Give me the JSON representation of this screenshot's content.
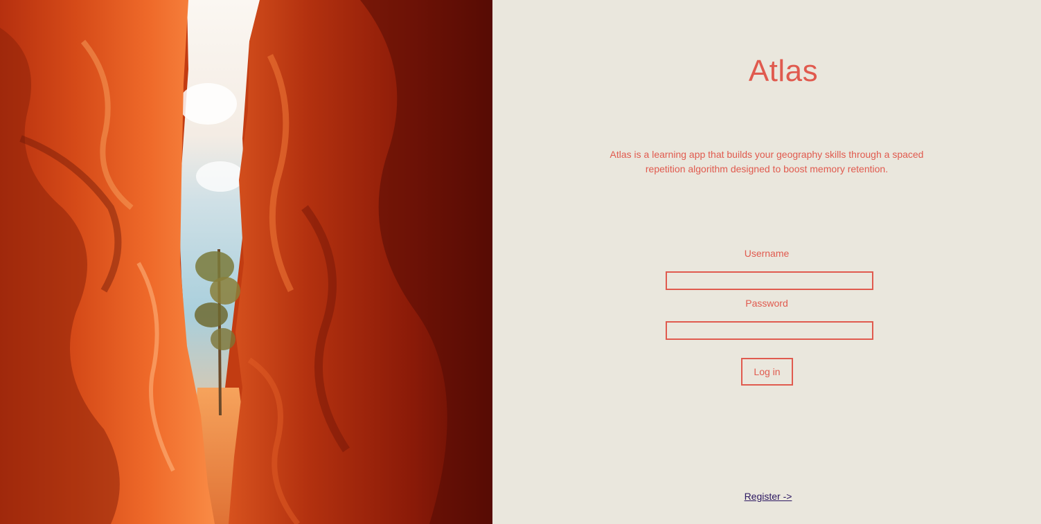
{
  "app": {
    "title": "Atlas",
    "description": "Atlas is a learning app that builds your geography skills through a spaced repetition algorithm designed to boost memory retention."
  },
  "hero_image": {
    "subject": "red sandstone canyon slot with sky and tree"
  },
  "login_form": {
    "username_label": "Username",
    "username_value": "",
    "password_label": "Password",
    "password_value": "",
    "login_button_label": "Log in"
  },
  "register_link_label": "Register ->",
  "colors": {
    "background": "#eae7dd",
    "accent": "#e05a4e",
    "link": "#2a1660"
  }
}
